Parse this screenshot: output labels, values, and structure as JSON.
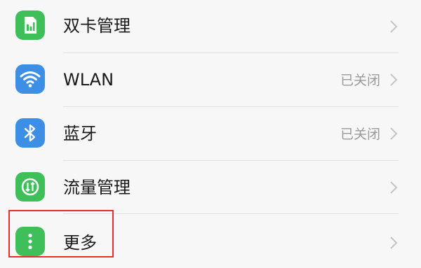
{
  "settings": {
    "items": [
      {
        "label": "双卡管理",
        "status": "",
        "icon": "sim-card-icon",
        "icon_color": "#3fbf5a"
      },
      {
        "label": "WLAN",
        "status": "已关闭",
        "icon": "wifi-icon",
        "icon_color": "#3d8fe6"
      },
      {
        "label": "蓝牙",
        "status": "已关闭",
        "icon": "bluetooth-icon",
        "icon_color": "#3d8fe6"
      },
      {
        "label": "流量管理",
        "status": "",
        "icon": "data-usage-icon",
        "icon_color": "#3fbf5a"
      },
      {
        "label": "更多",
        "status": "",
        "icon": "more-icon",
        "icon_color": "#3fbf5a"
      }
    ]
  },
  "highlight": {
    "color": "#e5302b",
    "target": "更多"
  }
}
